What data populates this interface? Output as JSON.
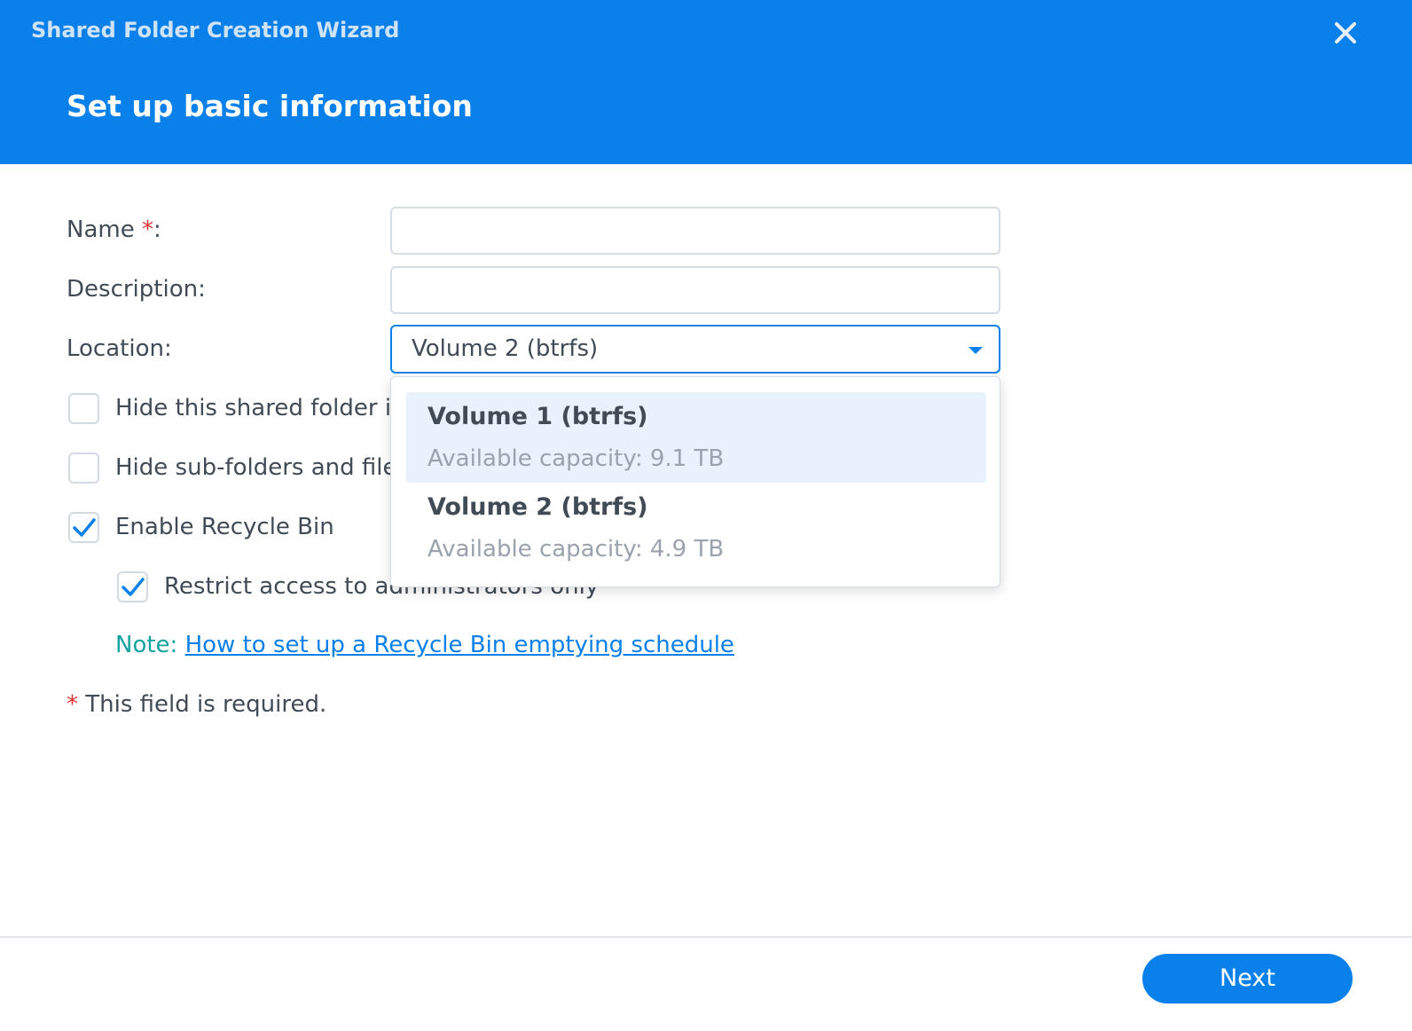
{
  "header": {
    "wizard_title": "Shared Folder Creation Wizard",
    "step_title": "Set up basic information",
    "close_icon": "close-icon"
  },
  "form": {
    "name_label": "Name ",
    "name_required_mark": "*",
    "name_colon": ":",
    "name_value": "",
    "description_label": "Description:",
    "description_value": "",
    "location_label": "Location:",
    "location_selected": "Volume 2 (btrfs)"
  },
  "options": [
    {
      "label": "Hide this shared folder i",
      "checked": false
    },
    {
      "label": "Hide sub-folders and file",
      "checked": false
    },
    {
      "label": "Enable Recycle Bin",
      "checked": true
    },
    {
      "label": "Restrict access to administrators only",
      "checked": true
    }
  ],
  "note": {
    "prefix": "Note: ",
    "link_text": "How to set up a Recycle Bin emptying schedule"
  },
  "required_note": {
    "star": "*",
    "text": " This field is required."
  },
  "dropdown": {
    "options": [
      {
        "name": "Volume 1 (btrfs)",
        "capacity": "Available capacity: 9.1 TB",
        "highlighted": true
      },
      {
        "name": "Volume 2 (btrfs)",
        "capacity": "Available capacity: 4.9 TB",
        "highlighted": false
      }
    ]
  },
  "footer": {
    "next_label": "Next"
  },
  "colors": {
    "accent": "#0a80ea",
    "required": "#e0322e",
    "note": "#12a3a0"
  }
}
